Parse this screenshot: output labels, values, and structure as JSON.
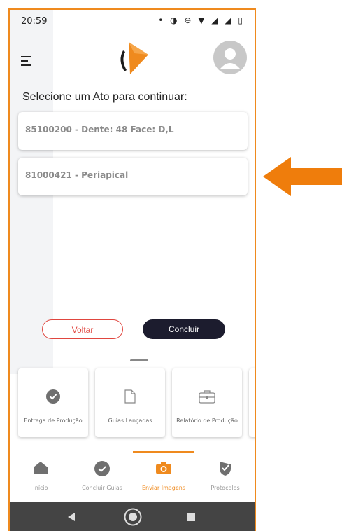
{
  "status_bar": {
    "time": "20:59",
    "icons": "• ◑ ⊖ ▼ ◢ ◢ ▯"
  },
  "header": {
    "menu_icon": "menu-icon",
    "logo": "brand-logo",
    "avatar": "user-avatar-icon"
  },
  "page": {
    "title": "Selecione um Ato para continuar:"
  },
  "acts": [
    {
      "label": "85100200 - Dente: 48 Face: D,L"
    },
    {
      "label": "81000421 - Periapical"
    }
  ],
  "actions": {
    "back_label": "Voltar",
    "finish_label": "Concluir"
  },
  "tiles": [
    {
      "label": "Entrega de Produção",
      "icon": "check-circle-icon"
    },
    {
      "label": "Guias Lançadas",
      "icon": "document-icon"
    },
    {
      "label": "Relatório de Produção",
      "icon": "briefcase-icon"
    }
  ],
  "bottom_nav": [
    {
      "label": "Início",
      "icon": "home-icon"
    },
    {
      "label": "Concluir Guias",
      "icon": "check-circle-icon"
    },
    {
      "label": "Enviar Imagens",
      "icon": "camera-icon",
      "active": true
    },
    {
      "label": "Protocolos",
      "icon": "shield-icon"
    }
  ],
  "colors": {
    "accent": "#ef8a1e",
    "danger": "#e0463f",
    "dark_button": "#1c1c2e",
    "system_nav": "#444444"
  }
}
